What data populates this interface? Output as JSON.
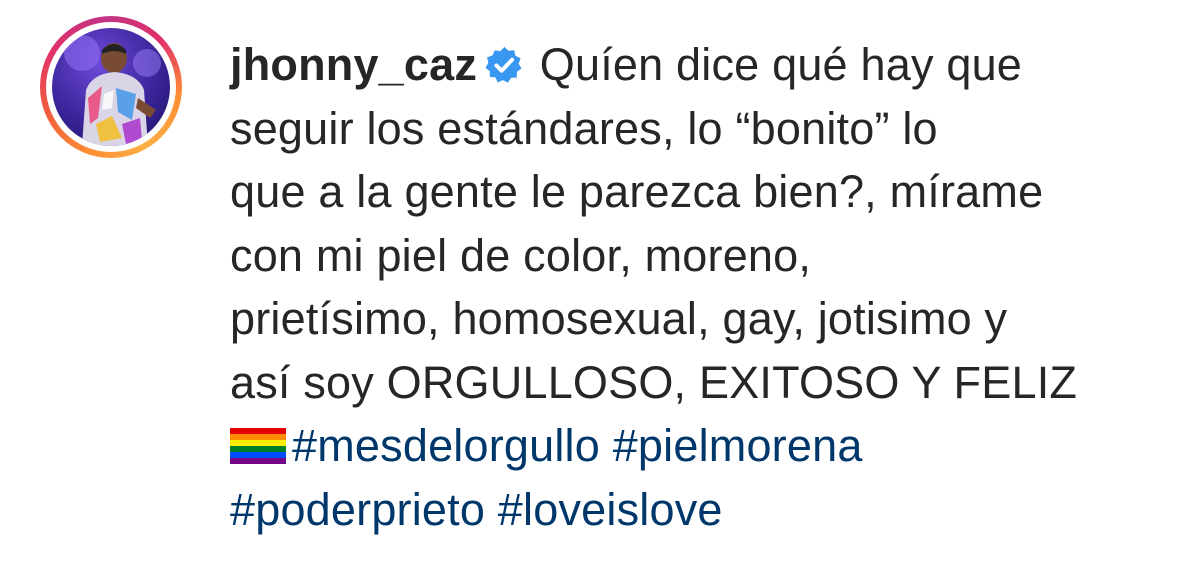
{
  "post": {
    "username": "jhonny_caz",
    "verified": true,
    "caption_lines": [
      "Quíen dice qué hay que",
      "seguir los estándares, lo “bonito” lo",
      "que a la gente le parezca bien?, mírame",
      "con mi piel de color, moreno,",
      "prietísimo, homosexual, gay, jotisimo y",
      "así soy ORGULLOSO, EXITOSO Y FELIZ"
    ],
    "flag_emoji": "rainbow-flag-icon",
    "hashtags": [
      "#mesdelorgullo",
      "#pielmorena",
      "#poderprieto",
      "#loveislove"
    ]
  },
  "colors": {
    "text": "#262626",
    "hashtag": "#00376b",
    "verified_badge": "#3897f0",
    "story_ring": [
      "#fcaf45",
      "#e1306c",
      "#c13584"
    ]
  }
}
